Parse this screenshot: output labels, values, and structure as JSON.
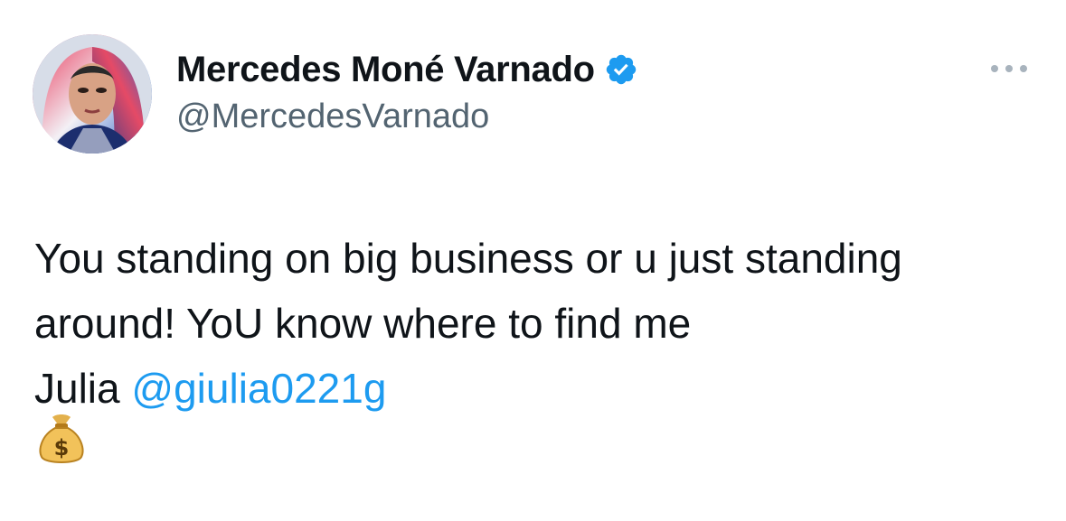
{
  "author": {
    "display_name": "Mercedes Moné Varnado",
    "handle": "@MercedesVarnado",
    "verified": true,
    "verified_color": "#1d9bf0"
  },
  "menu": {
    "icon": "more-horizontal-icon"
  },
  "tweet": {
    "line1": "You standing on big business or u just standing",
    "line2": "around! YoU know where to find me",
    "line3_prefix": "Julia ",
    "mention": "@giulia0221g",
    "emoji": "💰",
    "mention_color": "#1d9bf0"
  }
}
